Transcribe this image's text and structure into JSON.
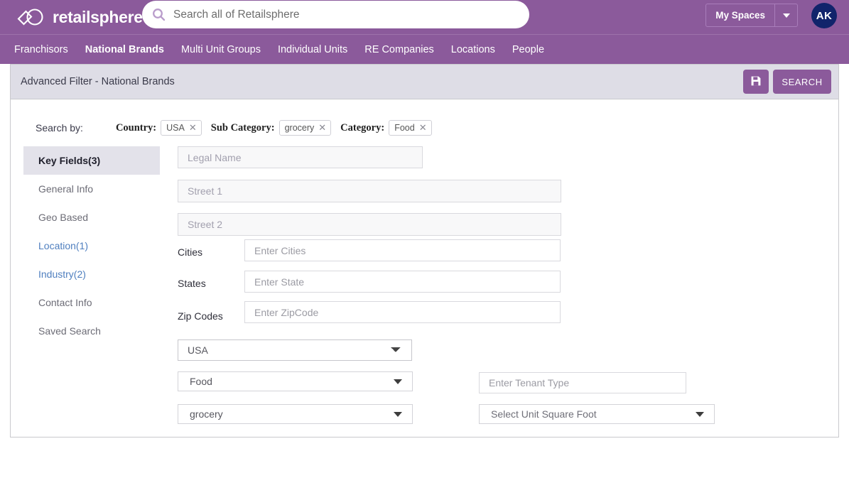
{
  "brand": {
    "name": "retailsphere",
    "logo_icon": "tag-circle-icon",
    "purple": "#8b5a9b",
    "avatar_navy": "#11246b"
  },
  "header": {
    "search": {
      "placeholder": "Search all of Retailsphere",
      "value": "",
      "icon": "search-icon"
    },
    "my_spaces_label": "My Spaces",
    "my_spaces_caret_icon": "chevron-down-icon",
    "avatar_initials": "AK"
  },
  "nav": {
    "items": [
      {
        "label": "Franchisors",
        "active": false
      },
      {
        "label": "National Brands",
        "active": true
      },
      {
        "label": "Multi Unit Groups",
        "active": false
      },
      {
        "label": "Individual Units",
        "active": false
      },
      {
        "label": "RE Companies",
        "active": false
      },
      {
        "label": "Locations",
        "active": false
      },
      {
        "label": "People",
        "active": false
      }
    ]
  },
  "panel": {
    "title": "Advanced Filter - National Brands",
    "save_icon": "save-floppy-icon",
    "search_button_label": "SEARCH"
  },
  "search_by": {
    "label": "Search by:",
    "criteria": [
      {
        "label": "Country:",
        "chip": "USA",
        "remove_icon": "close-icon"
      },
      {
        "label": "Sub Category:",
        "chip": "grocery",
        "remove_icon": "close-icon"
      },
      {
        "label": "Category:",
        "chip": "Food",
        "remove_icon": "close-icon"
      }
    ]
  },
  "sidebar": {
    "items": [
      {
        "label": "Key Fields(3)",
        "state": "active"
      },
      {
        "label": "General Info",
        "state": "normal"
      },
      {
        "label": "Geo Based",
        "state": "normal"
      },
      {
        "label": "Location(1)",
        "state": "link"
      },
      {
        "label": "Industry(2)",
        "state": "link"
      },
      {
        "label": "Contact Info",
        "state": "normal"
      },
      {
        "label": "Saved Search",
        "state": "normal"
      }
    ]
  },
  "form": {
    "legal_name": {
      "placeholder": "Legal Name",
      "value": ""
    },
    "street1": {
      "placeholder": "Street 1",
      "value": ""
    },
    "street2": {
      "placeholder": "Street 2",
      "value": ""
    },
    "cities": {
      "label": "Cities",
      "placeholder": "Enter Cities",
      "value": ""
    },
    "states": {
      "label": "States",
      "placeholder": "Enter State",
      "value": ""
    },
    "zip_codes": {
      "label": "Zip Codes",
      "placeholder": "Enter ZipCode",
      "value": ""
    },
    "country_select": {
      "value": "USA",
      "options": [
        "USA"
      ]
    },
    "category_select": {
      "value": "Food",
      "caret_icon": "caret-down-icon"
    },
    "subcategory_select": {
      "value": "grocery",
      "caret_icon": "caret-down-icon"
    },
    "tenant_type": {
      "placeholder": "Enter Tenant Type",
      "value": ""
    },
    "unit_square_foot": {
      "value": "Select Unit Square Foot",
      "caret_icon": "caret-down-icon"
    }
  }
}
